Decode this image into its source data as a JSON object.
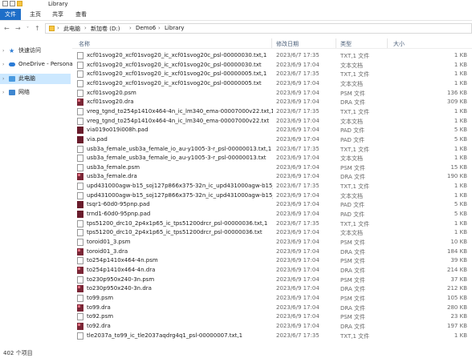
{
  "window": {
    "title": "Library"
  },
  "ribbon": {
    "tabs": [
      "文件",
      "主页",
      "共享",
      "查看"
    ]
  },
  "address": {
    "crumbs": [
      "此电脑",
      "新加卷 (D:)",
      "Demo6",
      "Library"
    ]
  },
  "sidebar": {
    "items": [
      {
        "label": "快速访问",
        "icon": "star-icon"
      },
      {
        "label": "OneDrive - Persona",
        "icon": "cloud-icon"
      },
      {
        "label": "此电脑",
        "icon": "computer-icon"
      },
      {
        "label": "网络",
        "icon": "network-icon"
      }
    ]
  },
  "columns": {
    "name": "名称",
    "date": "修改日期",
    "type": "类型",
    "size": "大小"
  },
  "files": [
    {
      "name": "xcf01svog20_xcf01svog20_ic_xcf01svog20c_psl-00000030.txt,1",
      "date": "2023/6/7 17:35",
      "type": "TXT,1 文件",
      "size": "1 KB",
      "icon": "txt"
    },
    {
      "name": "xcf01svog20_xcf01svog20_ic_xcf01svog20c_psl-00000030.txt",
      "date": "2023/6/9 17:04",
      "type": "文本文档",
      "size": "1 KB",
      "icon": "txt"
    },
    {
      "name": "xcf01svog20_xcf01svog20_ic_xcf01svog20c_psl-00000005.txt,1",
      "date": "2023/6/7 17:35",
      "type": "TXT,1 文件",
      "size": "1 KB",
      "icon": "txt"
    },
    {
      "name": "xcf01svog20_xcf01svog20_ic_xcf01svog20c_psl-00000005.txt",
      "date": "2023/6/9 17:04",
      "type": "文本文档",
      "size": "1 KB",
      "icon": "txt"
    },
    {
      "name": "xcf01svog20.psm",
      "date": "2023/6/9 17:04",
      "type": "PSM 文件",
      "size": "136 KB",
      "icon": "psm"
    },
    {
      "name": "xcf01svog20.dra",
      "date": "2023/6/9 17:04",
      "type": "DRA 文件",
      "size": "309 KB",
      "icon": "dra"
    },
    {
      "name": "vreg_tgnd_to254p1410x464-4n_ic_lm340_ema-00007000v22.txt,1",
      "date": "2023/6/7 17:35",
      "type": "TXT,1 文件",
      "size": "1 KB",
      "icon": "txt"
    },
    {
      "name": "vreg_tgnd_to254p1410x464-4n_ic_lm340_ema-00007000v22.txt",
      "date": "2023/6/9 17:04",
      "type": "文本文档",
      "size": "1 KB",
      "icon": "txt"
    },
    {
      "name": "via019o019i008h.pad",
      "date": "2023/6/9 17:04",
      "type": "PAD 文件",
      "size": "5 KB",
      "icon": "pad"
    },
    {
      "name": "via.pad",
      "date": "2023/6/9 17:04",
      "type": "PAD 文件",
      "size": "5 KB",
      "icon": "pad"
    },
    {
      "name": "usb3a_female_usb3a_female_io_au-y1005-3-r_psl-00000013.txt,1",
      "date": "2023/6/7 17:35",
      "type": "TXT,1 文件",
      "size": "1 KB",
      "icon": "txt"
    },
    {
      "name": "usb3a_female_usb3a_female_io_au-y1005-3-r_psl-00000013.txt",
      "date": "2023/6/9 17:04",
      "type": "文本文档",
      "size": "1 KB",
      "icon": "txt"
    },
    {
      "name": "usb3a_female.psm",
      "date": "2023/6/9 17:04",
      "type": "PSM 文件",
      "size": "15 KB",
      "icon": "psm"
    },
    {
      "name": "usb3a_female.dra",
      "date": "2023/6/9 17:04",
      "type": "DRA 文件",
      "size": "190 KB",
      "icon": "dra"
    },
    {
      "name": "upd431000agw-b15_soj127p866x375-32n_ic_upd431000agw-b15_psl...",
      "date": "2023/6/7 17:35",
      "type": "TXT,1 文件",
      "size": "1 KB",
      "icon": "txt"
    },
    {
      "name": "upd431000agw-b15_soj127p866x375-32n_ic_upd431000agw-b15_psl...",
      "date": "2023/6/9 17:04",
      "type": "文本文档",
      "size": "1 KB",
      "icon": "txt"
    },
    {
      "name": "tsqr1-60d0-95pnp.pad",
      "date": "2023/6/9 17:04",
      "type": "PAD 文件",
      "size": "5 KB",
      "icon": "pad"
    },
    {
      "name": "trnd1-60d0-95pnp.pad",
      "date": "2023/6/9 17:04",
      "type": "PAD 文件",
      "size": "5 KB",
      "icon": "pad"
    },
    {
      "name": "tps51200_drc10_2p4x1p65_ic_tps51200drcr_psl-00000036.txt,1",
      "date": "2023/6/7 17:35",
      "type": "TXT,1 文件",
      "size": "1 KB",
      "icon": "txt"
    },
    {
      "name": "tps51200_drc10_2p4x1p65_ic_tps51200drcr_psl-00000036.txt",
      "date": "2023/6/9 17:04",
      "type": "文本文档",
      "size": "1 KB",
      "icon": "txt"
    },
    {
      "name": "toroid01_3.psm",
      "date": "2023/6/9 17:04",
      "type": "PSM 文件",
      "size": "10 KB",
      "icon": "psm"
    },
    {
      "name": "toroid01_3.dra",
      "date": "2023/6/9 17:04",
      "type": "DRA 文件",
      "size": "184 KB",
      "icon": "dra"
    },
    {
      "name": "to254p1410x464-4n.psm",
      "date": "2023/6/9 17:04",
      "type": "PSM 文件",
      "size": "39 KB",
      "icon": "psm"
    },
    {
      "name": "to254p1410x464-4n.dra",
      "date": "2023/6/9 17:04",
      "type": "DRA 文件",
      "size": "214 KB",
      "icon": "dra"
    },
    {
      "name": "to230p950x240-3n.psm",
      "date": "2023/6/9 17:04",
      "type": "PSM 文件",
      "size": "37 KB",
      "icon": "psm"
    },
    {
      "name": "to230p950x240-3n.dra",
      "date": "2023/6/9 17:04",
      "type": "DRA 文件",
      "size": "212 KB",
      "icon": "dra"
    },
    {
      "name": "to99.psm",
      "date": "2023/6/9 17:04",
      "type": "PSM 文件",
      "size": "105 KB",
      "icon": "psm"
    },
    {
      "name": "to99.dra",
      "date": "2023/6/9 17:04",
      "type": "DRA 文件",
      "size": "280 KB",
      "icon": "dra"
    },
    {
      "name": "to92.psm",
      "date": "2023/6/9 17:04",
      "type": "PSM 文件",
      "size": "23 KB",
      "icon": "psm"
    },
    {
      "name": "to92.dra",
      "date": "2023/6/9 17:04",
      "type": "DRA 文件",
      "size": "197 KB",
      "icon": "dra"
    },
    {
      "name": "tle2037a_to99_ic_tle2037aqdrg4q1_psl-00000007.txt,1",
      "date": "2023/6/7 17:35",
      "type": "TXT,1 文件",
      "size": "1 KB",
      "icon": "txt"
    }
  ],
  "status": {
    "count": "402 个项目"
  },
  "colors": {
    "accent": "#1e6ec8",
    "selected": "#cce8ff"
  }
}
